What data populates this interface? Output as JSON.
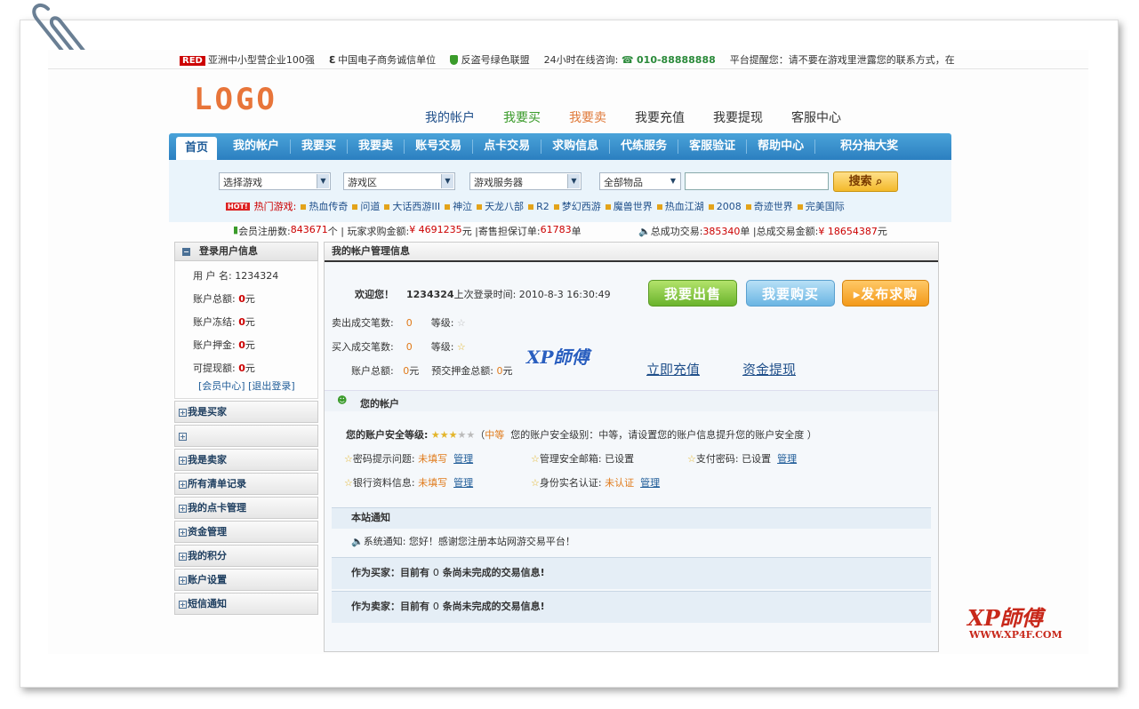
{
  "topbar": {
    "badge": "RED",
    "award": "亚洲中小型营企业100强",
    "credit": "中国电子商务诚信单位",
    "alliance": "反盗号绿色联盟",
    "hotline_label": "24小时在线咨询:",
    "phone": "010-88888888",
    "notice": "平台提醒您：请不要在游戏里泄露您的联系方式，在"
  },
  "logo": "LOGO",
  "topnav": [
    "我的帐户",
    "我要买",
    "我要卖",
    "我要充值",
    "我要提现",
    "客服中心"
  ],
  "mainnav": [
    "首页",
    "我的帐户",
    "我要买",
    "我要卖",
    "账号交易",
    "点卡交易",
    "求购信息",
    "代练服务",
    "客服验证",
    "帮助中心",
    "积分抽大奖"
  ],
  "search": {
    "game": "选择游戏",
    "zone": "游戏区",
    "server": "游戏服务器",
    "items": "全部物品",
    "button": "搜索"
  },
  "hot": {
    "badge": "HOT!",
    "label": "热门游戏:",
    "games": [
      "热血传奇",
      "问道",
      "大话西游III",
      "神泣",
      "天龙八部",
      "R2",
      "梦幻西游",
      "魔兽世界",
      "热血江湖",
      "2008",
      "奇迹世界",
      "完美国际"
    ]
  },
  "stats": {
    "reg_label": "会员注册数:",
    "reg_value": "843671",
    "reg_unit": "个 | 玩家求购金额:",
    "buy_value": "¥ 4691235",
    "buy_unit": "元 |寄售担保订单:",
    "order_value": "61783",
    "order_unit": "单",
    "deal_label": "总成功交易:",
    "deal_value": "385340",
    "deal_unit": "单 |总成交易金额:",
    "amount_value": "¥ 18654387",
    "amount_unit": "元"
  },
  "sidebar": {
    "title": "登录用户信息",
    "username_label": "用 户 名:",
    "username": "1234324",
    "rows": [
      {
        "label": "账户总额:",
        "value": "0",
        "unit": "元"
      },
      {
        "label": "账户冻结:",
        "value": "0",
        "unit": "元"
      },
      {
        "label": "账户押金:",
        "value": "0",
        "unit": "元"
      },
      {
        "label": "可提现额:",
        "value": "0",
        "unit": "元"
      }
    ],
    "link_center": "[会员中心]",
    "link_logout": "[退出登录]",
    "items": [
      "我是买家",
      "",
      "我是卖家",
      "所有清单记录",
      "我的点卡管理",
      "资金管理",
      "我的积分",
      "账户设置",
      "短信通知"
    ]
  },
  "main": {
    "title": "我的帐户管理信息",
    "welcome": "欢迎您！",
    "user": "1234324",
    "last_login_label": "上次登录时间:",
    "last_login": "2010-8-3 16:30:49",
    "btn_sell": "我要出售",
    "btn_buy": "我要购买",
    "btn_post": "发布求购",
    "sell_label": "卖出成交笔数:",
    "sell_count": "0",
    "buy_label": "买入成交笔数:",
    "buy_count": "0",
    "level_label": "等级:",
    "total_label": "账户总额:",
    "total_value": "0",
    "total_unit": "元",
    "deposit_label": "预交押金总额:",
    "deposit_value": "0",
    "deposit_unit": "元",
    "recharge": "立即充值",
    "withdraw": "资金提现",
    "account_section": "您的帐户",
    "security_label": "您的账户安全等级:",
    "security_paren_open": "（",
    "security_level": "中等",
    "security_text": "您的账户安全级别：中等，请设置您的账户信息提升您的账户安全度 ）",
    "security_stars": 3,
    "items": [
      {
        "label": "密码提示问题:",
        "status": "未填写",
        "action": "管理"
      },
      {
        "label": "管理安全邮箱:",
        "status": "已设置",
        "action": ""
      },
      {
        "label": "支付密码:",
        "status": "已设置",
        "action": "管理"
      },
      {
        "label": "银行资料信息:",
        "status": "未填写",
        "action": "管理"
      },
      {
        "label": "身份实名认证:",
        "status": "未认证",
        "action": "管理"
      }
    ],
    "notice_title": "本站通知",
    "notice_label": "系统通知:",
    "notice_text": "您好！感谢您注册本站网游交易平台！",
    "buyer_label": "作为买家：目前有",
    "buyer_count": "0",
    "buyer_text": "条尚未完成的交易信息!",
    "seller_label": "作为卖家：目前有",
    "seller_count": "0",
    "seller_text": "条尚未完成的交易信息!"
  },
  "watermark": {
    "center": "XP師傅",
    "corner": "XP師傅",
    "url": "WWW.XP4F.COM"
  }
}
